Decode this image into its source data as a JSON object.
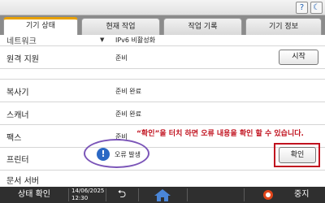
{
  "topbar": {
    "help_glyph": "?",
    "moon_glyph": "☾"
  },
  "tabs": [
    {
      "label": "기기 상태",
      "active": true
    },
    {
      "label": "현재 작업",
      "active": false
    },
    {
      "label": "작업 기록",
      "active": false
    },
    {
      "label": "기기 정보",
      "active": false
    }
  ],
  "rows": {
    "network": {
      "label": "네트워크",
      "status": "IPv6 비활성화"
    },
    "remote": {
      "label": "원격 지원",
      "status": "준비",
      "button": "시작"
    },
    "copier": {
      "label": "복사기",
      "status": "준비 완료"
    },
    "scanner": {
      "label": "스캐너",
      "status": "준비 완료"
    },
    "fax": {
      "label": "팩스",
      "status": "준비"
    },
    "printer": {
      "label": "프린터",
      "status": "오류 발생",
      "button": "확인"
    },
    "docserver": {
      "label": "문서 서버"
    }
  },
  "annotation": {
    "text": "“확인”을 터치 하면 오류 내용을 확인 할 수 있습니다."
  },
  "bottom": {
    "status_check": "상태 확인",
    "date": "14/06/2025",
    "time": "12:30",
    "back_glyph": "⮌",
    "stop_label": "중지"
  },
  "colors": {
    "accent_tab": "#e8a000",
    "annotation_red": "#c1121f",
    "annotation_purple": "#7b55b8",
    "info_blue": "#2b68c4",
    "home_blue": "#4a86d8",
    "stop_orange": "#e0461b"
  },
  "icons": {
    "help": "help-icon",
    "sleep": "moon-icon",
    "network": "network-arrow-icon",
    "info": "info-icon",
    "back": "back-arrow-icon",
    "home": "home-icon",
    "stop": "stop-icon"
  }
}
